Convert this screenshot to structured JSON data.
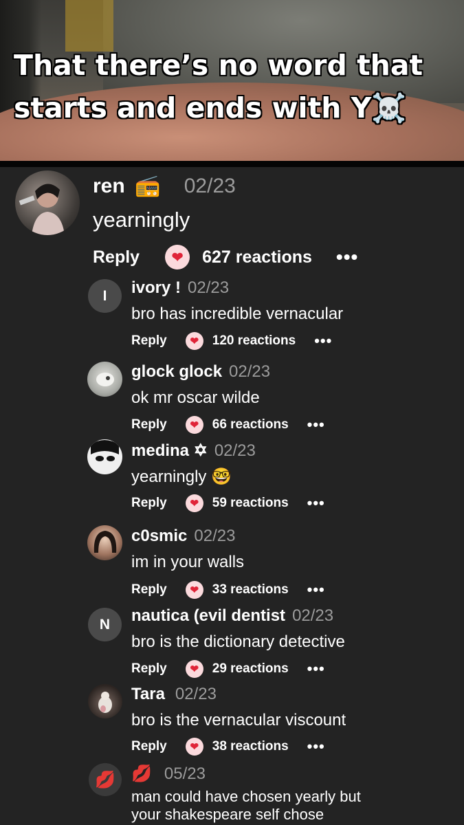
{
  "video": {
    "caption": "That there’s no word that starts and ends with Y☠️"
  },
  "main_comment": {
    "username": "ren",
    "username_emoji": "📻",
    "date": "02/23",
    "text": "yearningly",
    "reply_label": "Reply",
    "reactions": "627 reactions",
    "more": "•••"
  },
  "replies": [
    {
      "initial": "I",
      "username": "ivory !",
      "date": "02/23",
      "text": "bro has incredible vernacular",
      "reply_label": "Reply",
      "reactions": "120 reactions",
      "more": "•••"
    },
    {
      "username": "glock glock",
      "date": "02/23",
      "text": "ok mr oscar wilde",
      "reply_label": "Reply",
      "reactions": "66 reactions",
      "more": "•••"
    },
    {
      "username": "medina ✡",
      "date": "02/23",
      "text": "yearningly 🤓",
      "reply_label": "Reply",
      "reactions": "59 reactions",
      "more": "•••"
    },
    {
      "username": "c0smic",
      "date": "02/23",
      "text": "im in your walls",
      "reply_label": "Reply",
      "reactions": "33 reactions",
      "more": "•••"
    },
    {
      "initial": "N",
      "username": "nautica (evil dentist",
      "date": "02/23",
      "text": "bro is the dictionary detective",
      "reply_label": "Reply",
      "reactions": "29 reactions",
      "more": "•••"
    },
    {
      "username": "Tara",
      "date": "02/23",
      "text": "bro is the vernacular viscount",
      "reply_label": "Reply",
      "reactions": "38 reactions",
      "more": "•••"
    },
    {
      "username": "💋",
      "date": "05/23",
      "text_line1": "man could have chosen yearly but",
      "text_line2": "your shakespeare self chose"
    }
  ],
  "colors": {
    "background": "#232323",
    "date": "#9c9c9c",
    "heart_bg": "#fbdadd",
    "heart": "#e02438"
  },
  "icons": {
    "reaction": "heart-icon",
    "more": "more-dots-icon"
  }
}
